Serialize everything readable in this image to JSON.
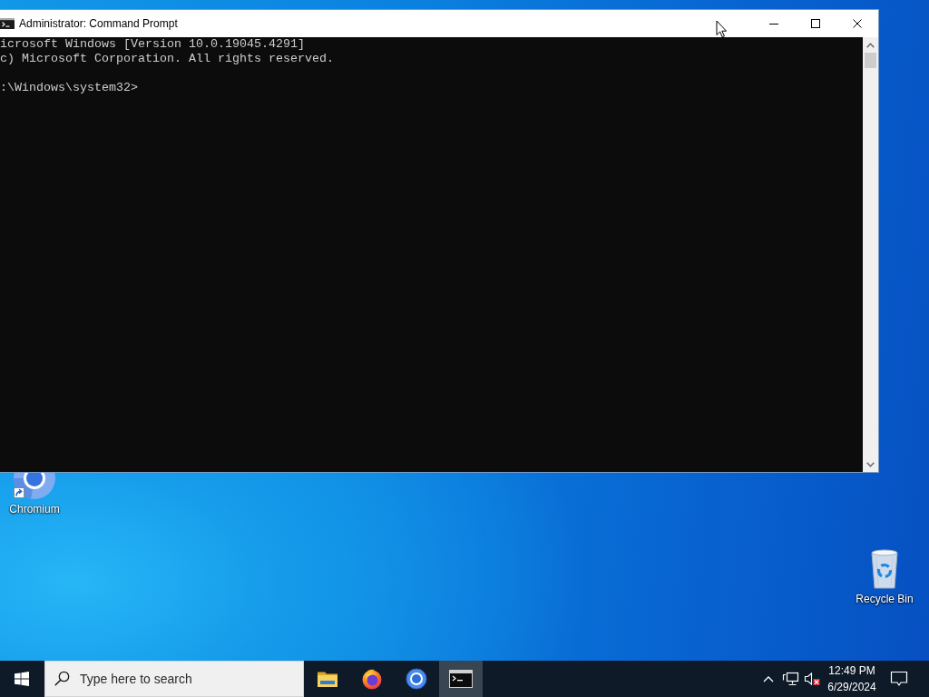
{
  "window": {
    "title": "Administrator: Command Prompt",
    "console": {
      "lines": [
        "icrosoft Windows [Version 10.0.19045.4291]",
        "c) Microsoft Corporation. All rights reserved."
      ],
      "prompt": ":\\Windows\\system32>"
    }
  },
  "desktop_icons": [
    {
      "label": "Chromium",
      "kind": "chromium"
    },
    {
      "label": "Recycle Bin",
      "kind": "recycle-bin"
    }
  ],
  "taskbar": {
    "search": {
      "placeholder": "Type here to search"
    },
    "apps": [
      {
        "kind": "file-explorer",
        "selected": false
      },
      {
        "kind": "firefox",
        "selected": false
      },
      {
        "kind": "chromium",
        "selected": false
      },
      {
        "kind": "command-prompt",
        "selected": true
      }
    ],
    "tray": {
      "muted": true
    },
    "clock": {
      "time": "12:49 PM",
      "date": "6/29/2024"
    }
  }
}
